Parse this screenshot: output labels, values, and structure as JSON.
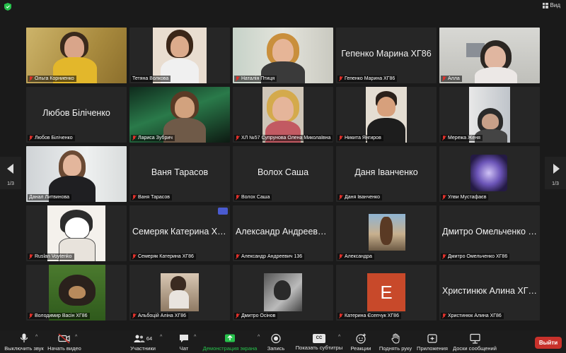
{
  "top": {
    "view_label": "Вид"
  },
  "pager": {
    "left": "1/3",
    "right": "1/3"
  },
  "tiles": [
    {
      "name": "Ольга Корниенко"
    },
    {
      "name": "Тетяна Волкова"
    },
    {
      "name": "Наталія Птиця"
    },
    {
      "name": "Гепенко Марина ХГ86",
      "center": "Гепенко Марина ХГ86"
    },
    {
      "name": "Алла"
    },
    {
      "name": "Любов Біліченко",
      "center": "Любов Біліченко"
    },
    {
      "name": "Лариса Зубрич"
    },
    {
      "name": "ХЛ №57 Супрунова Олена Миколаївна"
    },
    {
      "name": "Никита Янгиров"
    },
    {
      "name": "Мережа Женя"
    },
    {
      "name": "Данал Литвинова"
    },
    {
      "name": "Ваня Тарасов",
      "center": "Ваня Тарасов"
    },
    {
      "name": "Волох Саша",
      "center": "Волох Саша"
    },
    {
      "name": "Даня Іванченко",
      "center": "Даня Іванченко"
    },
    {
      "name": "Улви Мустафаєв"
    },
    {
      "name": "Ruslan Voytenko"
    },
    {
      "name": "Семеряк Катерина ХГ86",
      "center": "Семеряк Катерина ХГ86"
    },
    {
      "name": "Александр Андреевич 136",
      "center": "Александр Андреевич..."
    },
    {
      "name": "Александра"
    },
    {
      "name": "Дмитро Омельченко ХГ86",
      "center": "Дмитро Омельченко Х..."
    },
    {
      "name": "Володимир Васін ХГ86"
    },
    {
      "name": "Альбоцій Аліна ХГ86"
    },
    {
      "name": "Дмитро Осінов"
    },
    {
      "name": "Катерина Єсепчук ХГ86",
      "avatar_letter": "E"
    },
    {
      "name": "Христинюк Алина ХГ86",
      "center": "Христинюк Алина ХГ86"
    }
  ],
  "toolbar": {
    "mute": "Выключить звук",
    "video": "Начать видео",
    "participants": "Участники",
    "participants_count": "64",
    "chat": "Чат",
    "share": "Демонстрация экрана",
    "record": "Запись",
    "captions": "Показать субтитры",
    "captions_badge": "CC",
    "reactions": "Реакции",
    "raise_hand": "Поднять руку",
    "apps": "Приложения",
    "whiteboards": "Доски сообщений",
    "leave": "Выйти"
  },
  "colors": {
    "accent_green": "#27c24c",
    "leave_red": "#c8312b",
    "mic_off_red": "#e0312b",
    "tile_bg": "#262626"
  }
}
